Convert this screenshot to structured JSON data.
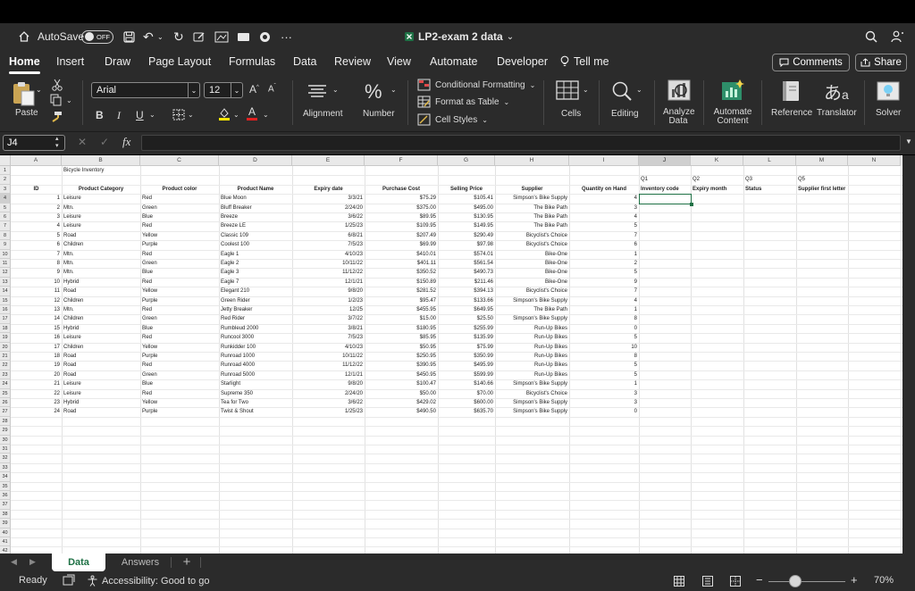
{
  "titlebar": {
    "autosave_label": "AutoSave",
    "autosave_state": "OFF",
    "more": "···",
    "doc_title": "LP2-exam 2 data",
    "doc_chevron": "⌄"
  },
  "ribbon_tabs": [
    "Home",
    "Insert",
    "Draw",
    "Page Layout",
    "Formulas",
    "Data",
    "Review",
    "View",
    "Automate",
    "Developer",
    "Tell me"
  ],
  "comments_label": "Comments",
  "share_label": "Share",
  "ribbon": {
    "paste": "Paste",
    "font_name": "Arial",
    "font_size": "12",
    "bold": "B",
    "italic": "I",
    "underline": "U",
    "alignment": "Alignment",
    "number": "Number",
    "cond_format": "Conditional Formatting",
    "format_table": "Format as Table",
    "cell_styles": "Cell Styles",
    "cells": "Cells",
    "editing": "Editing",
    "analyze": "Analyze Data",
    "automate": "Automate Content",
    "reference": "Reference",
    "translator": "Translator",
    "solver": "Solver"
  },
  "formula": {
    "name_box": "J4",
    "fx": "fx",
    "value": ""
  },
  "columns": [
    "A",
    "B",
    "C",
    "D",
    "E",
    "F",
    "G",
    "H",
    "I",
    "J",
    "K",
    "L",
    "M",
    "N"
  ],
  "row_count": 42,
  "sheet_title": "Bicycle Inventory",
  "question_row": [
    "Q1",
    "Q2",
    "Q3",
    "Q5"
  ],
  "headers": [
    "ID",
    "Product Category",
    "Product color",
    "Product Name",
    "Expiry date",
    "Purchase Cost",
    "Selling Price",
    "Supplier",
    "Quantity on Hand",
    "Inventory code",
    "Expiry month",
    "Status",
    "Supplier first letter"
  ],
  "rows": [
    [
      "1",
      "Leisure",
      "Red",
      "Blue Moon",
      "3/3/21",
      "$75.29",
      "$105.41",
      "Simpson's Bike Supply",
      "4"
    ],
    [
      "2",
      "Mtn.",
      "Green",
      "Bluff Breaker",
      "2/24/20",
      "$375.00",
      "$495.00",
      "The Bike Path",
      "3"
    ],
    [
      "3",
      "Leisure",
      "Blue",
      "Breeze",
      "3/6/22",
      "$89.95",
      "$130.95",
      "The Bike Path",
      "4"
    ],
    [
      "4",
      "Leisure",
      "Red",
      "Breeze LE",
      "1/25/23",
      "$109.95",
      "$149.95",
      "The Bike Path",
      "5"
    ],
    [
      "5",
      "Road",
      "Yellow",
      "Classic 109",
      "6/8/21",
      "$207.49",
      "$290.49",
      "Bicyclist's Choice",
      "7"
    ],
    [
      "6",
      "Children",
      "Purple",
      "Coolest 100",
      "7/5/23",
      "$69.99",
      "$97.98",
      "Bicyclist's Choice",
      "6"
    ],
    [
      "7",
      "Mtn.",
      "Red",
      "Eagle 1",
      "4/10/23",
      "$410.01",
      "$574.01",
      "Bike-One",
      "1"
    ],
    [
      "8",
      "Mtn.",
      "Green",
      "Eagle 2",
      "10/11/22",
      "$401.11",
      "$561.54",
      "Bike-One",
      "2"
    ],
    [
      "9",
      "Mtn.",
      "Blue",
      "Eagle 3",
      "11/12/22",
      "$350.52",
      "$490.73",
      "Bike-One",
      "5"
    ],
    [
      "10",
      "Hybrid",
      "Red",
      "Eagle 7",
      "12/1/21",
      "$150.89",
      "$211.46",
      "Bike-One",
      "9"
    ],
    [
      "11",
      "Road",
      "Yellow",
      "Elegant 210",
      "9/8/20",
      "$281.52",
      "$394.13",
      "Bicyclist's Choice",
      "7"
    ],
    [
      "12",
      "Children",
      "Purple",
      "Green Rider",
      "1/2/23",
      "$95.47",
      "$133.66",
      "Simpson's Bike Supply",
      "4"
    ],
    [
      "13",
      "Mtn.",
      "Red",
      "Jetty Breaker",
      "12/25",
      "$455.95",
      "$649.95",
      "The Bike Path",
      "1"
    ],
    [
      "14",
      "Children",
      "Green",
      "Red Rider",
      "3/7/22",
      "$15.00",
      "$25.50",
      "Simpson's Bike Supply",
      "8"
    ],
    [
      "15",
      "Hybrid",
      "Blue",
      "Rumbleud 2000",
      "3/8/21",
      "$180.95",
      "$255.99",
      "Run-Up Bikes",
      "0"
    ],
    [
      "16",
      "Leisure",
      "Red",
      "Runcool 3000",
      "7/5/23",
      "$85.95",
      "$135.99",
      "Run-Up Bikes",
      "5"
    ],
    [
      "17",
      "Children",
      "Yellow",
      "Runkidder 100",
      "4/10/23",
      "$50.95",
      "$75.99",
      "Run-Up Bikes",
      "10"
    ],
    [
      "18",
      "Road",
      "Purple",
      "Runroad 1000",
      "10/11/22",
      "$250.95",
      "$350.99",
      "Run-Up Bikes",
      "8"
    ],
    [
      "19",
      "Road",
      "Red",
      "Runroad 4000",
      "11/12/22",
      "$390.95",
      "$495.99",
      "Run-Up Bikes",
      "5"
    ],
    [
      "20",
      "Road",
      "Green",
      "Runroad 5000",
      "12/1/21",
      "$450.95",
      "$599.99",
      "Run-Up Bikes",
      "5"
    ],
    [
      "21",
      "Leisure",
      "Blue",
      "Starlight",
      "9/8/20",
      "$100.47",
      "$140.66",
      "Simpson's Bike Supply",
      "1"
    ],
    [
      "22",
      "Leisure",
      "Red",
      "Supreme 350",
      "2/24/20",
      "$50.00",
      "$70.00",
      "Bicyclist's Choice",
      "3"
    ],
    [
      "23",
      "Hybrid",
      "Yellow",
      "Tea for Two",
      "3/6/22",
      "$429.02",
      "$600.00",
      "Simpson's Bike Supply",
      "3"
    ],
    [
      "24",
      "Road",
      "Purple",
      "Twist & Shout",
      "1/25/23",
      "$490.50",
      "$635.70",
      "Simpson's Bike Supply",
      "0"
    ]
  ],
  "sheet_tabs": [
    "Data",
    "Answers"
  ],
  "add_sheet": "+",
  "status": {
    "ready": "Ready",
    "accessibility": "Accessibility: Good to go",
    "zoom": "70%"
  },
  "colors": {
    "accent": "#1e7145",
    "chrome": "#2b2b2b"
  }
}
